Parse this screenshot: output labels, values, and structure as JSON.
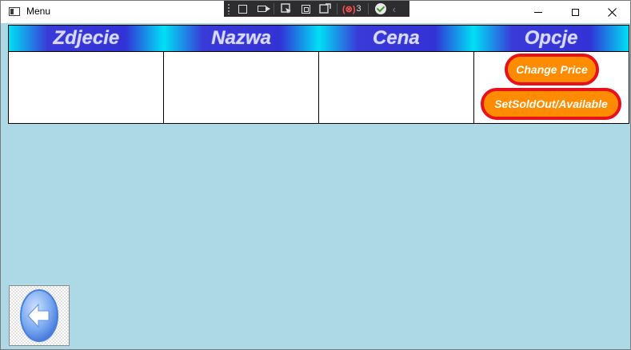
{
  "window": {
    "title": "Menu"
  },
  "grid": {
    "columns": [
      "Zdjecie",
      "Nazwa",
      "Cena",
      "Opcje"
    ],
    "rows": [
      {
        "photo": "",
        "name": "",
        "price": ""
      }
    ],
    "options": {
      "change_price_label": "Change Price",
      "sold_toggle_label": "SetSoldOut/Available"
    }
  },
  "debug_toolbar": {
    "binding_count": "3"
  },
  "colors": {
    "background": "#add8e6",
    "header_gradient_edge": "#00e0f5",
    "header_gradient_mid": "#3232d6",
    "button_fill": "#ff8c00",
    "button_border": "#e8101a"
  },
  "icons": {
    "back": "back-arrow-icon",
    "app": "window-app-icon",
    "minimize": "minimize-icon",
    "maximize": "maximize-icon",
    "close": "close-icon"
  }
}
